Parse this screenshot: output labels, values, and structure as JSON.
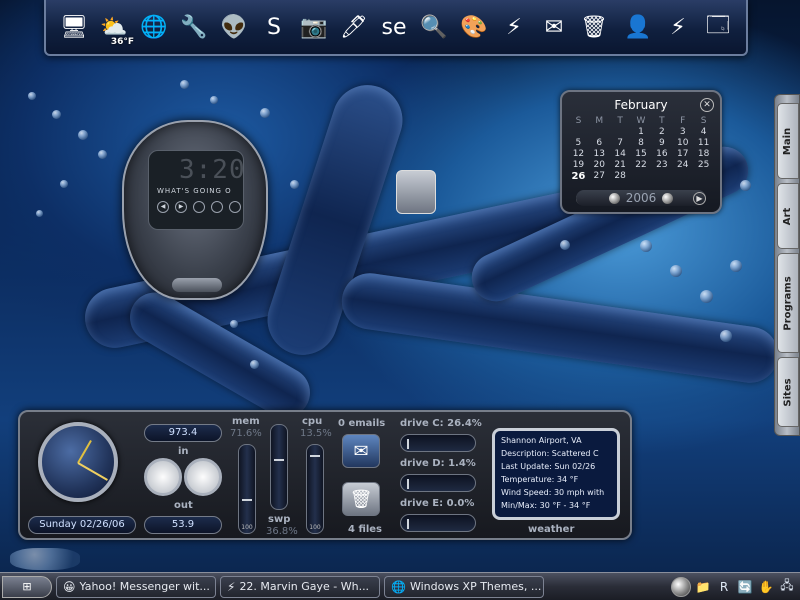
{
  "colors": {
    "accent": "#1b5a9a",
    "panel": "#17191f",
    "panel_border": "#777e8a",
    "weather_bg": "#0a1a3e",
    "text_light": "#dfe8f5"
  },
  "dock": {
    "icons": [
      {
        "name": "monitor-icon",
        "glyph": "🖥",
        "label": ""
      },
      {
        "name": "weather-icon",
        "glyph": "⛅",
        "label": "36°F"
      },
      {
        "name": "browser-icon",
        "glyph": "🌐",
        "label": ""
      },
      {
        "name": "tools-icon",
        "glyph": "🔧",
        "label": ""
      },
      {
        "name": "alien-icon",
        "glyph": "👽",
        "label": ""
      },
      {
        "name": "skype-icon",
        "glyph": "S",
        "label": ""
      },
      {
        "name": "camera-icon",
        "glyph": "📷",
        "label": ""
      },
      {
        "name": "monitor-pen-icon",
        "glyph": "🖊",
        "label": ""
      },
      {
        "name": "se-icon",
        "glyph": "se",
        "label": ""
      },
      {
        "name": "search-icon",
        "glyph": "🔍",
        "label": ""
      },
      {
        "name": "paint-icon",
        "glyph": "🎨",
        "label": ""
      },
      {
        "name": "lightning-icon",
        "glyph": "⚡",
        "label": ""
      },
      {
        "name": "mail-icon",
        "glyph": "✉",
        "label": ""
      },
      {
        "name": "recycle-bin-icon",
        "glyph": "🗑",
        "label": ""
      }
    ],
    "right_icons": [
      {
        "name": "user-icon",
        "glyph": "👤"
      },
      {
        "name": "lightning-icon",
        "glyph": "⚡"
      },
      {
        "name": "window-icon",
        "glyph": "🗔"
      }
    ]
  },
  "calendar": {
    "month": "February",
    "year": "2006",
    "weekday_headers": [
      "S",
      "M",
      "T",
      "W",
      "T",
      "F",
      "S"
    ],
    "weeks": [
      [
        "",
        "",
        "",
        "1",
        "2",
        "3",
        "4"
      ],
      [
        "5",
        "6",
        "7",
        "8",
        "9",
        "10",
        "11"
      ],
      [
        "12",
        "13",
        "14",
        "15",
        "16",
        "17",
        "18"
      ],
      [
        "19",
        "20",
        "21",
        "22",
        "23",
        "24",
        "25"
      ],
      [
        "26",
        "27",
        "28",
        "",
        "",
        "",
        ""
      ]
    ],
    "today": "26"
  },
  "player": {
    "time": "3:20",
    "track_title": "WHAT'S GOING O"
  },
  "system": {
    "date": "Sunday 02/26/06",
    "net_in_value": "973.4",
    "net_in_label": "in",
    "net_out_value": "53.9",
    "net_out_label": "out",
    "mem_label": "mem",
    "mem_value": "71.6%",
    "swp_label": "swp",
    "swp_value": "36.8%",
    "cpu_label": "cpu",
    "cpu_value": "13.5%",
    "bar_zero": "100",
    "emails_label": "0 emails",
    "files_label": "4 files",
    "drive_c": "drive C: 26.4%",
    "drive_d": "drive D: 1.4%",
    "drive_e": "drive E: 0.0%"
  },
  "weather": {
    "location": "Shannon Airport, VA",
    "description": "Description: Scattered C",
    "last_update": "Last Update: Sun 02/26",
    "temperature": "Temperature: 34 °F",
    "wind": "Wind Speed: 30 mph with",
    "minmax": "Min/Max: 30 °F - 34 °F",
    "label": "weather"
  },
  "sidetabs": [
    "Main",
    "Art",
    "Programs",
    "Sites"
  ],
  "taskbar": {
    "tasks": [
      {
        "icon": "😀",
        "icon_name": "yahoo-messenger-icon",
        "label": "Yahoo! Messenger wit..."
      },
      {
        "icon": "⚡",
        "icon_name": "winamp-icon",
        "label": "22. Marvin Gaye - Wh..."
      },
      {
        "icon": "🌐",
        "icon_name": "ie-icon",
        "label": "Windows XP Themes, ..."
      }
    ],
    "tray": [
      {
        "icon": "📁",
        "name": "folder-tray-icon"
      },
      {
        "icon": "R",
        "name": "r-tray-icon"
      },
      {
        "icon": "🔄",
        "name": "sync-tray-icon"
      },
      {
        "icon": "✋",
        "name": "hand-tray-icon"
      },
      {
        "icon": "🖧",
        "name": "network-tray-icon"
      }
    ]
  }
}
